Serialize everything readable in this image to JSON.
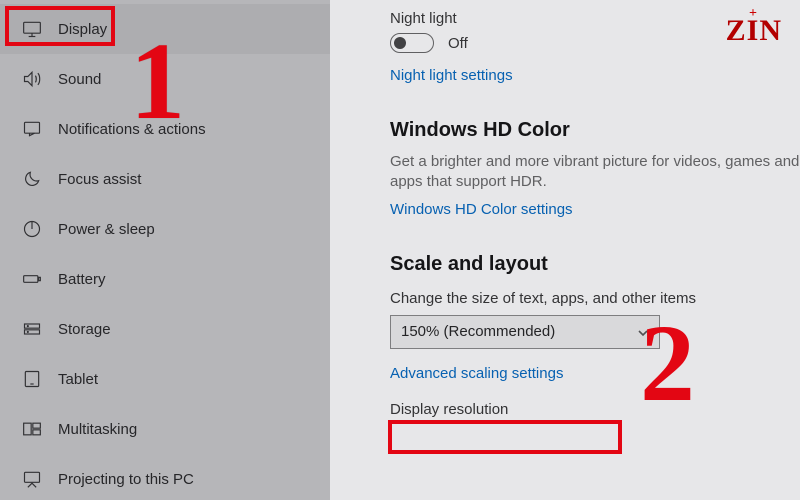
{
  "sidebar": {
    "items": [
      {
        "label": "Display"
      },
      {
        "label": "Sound"
      },
      {
        "label": "Notifications & actions"
      },
      {
        "label": "Focus assist"
      },
      {
        "label": "Power & sleep"
      },
      {
        "label": "Battery"
      },
      {
        "label": "Storage"
      },
      {
        "label": "Tablet"
      },
      {
        "label": "Multitasking"
      },
      {
        "label": "Projecting to this PC"
      }
    ]
  },
  "main": {
    "night_light_label": "Night light",
    "toggle_state": "Off",
    "night_light_link": "Night light settings",
    "hd_color_heading": "Windows HD Color",
    "hd_color_desc": "Get a brighter and more vibrant picture for videos, games and apps that support HDR.",
    "hd_color_link": "Windows HD Color settings",
    "scale_heading": "Scale and layout",
    "scale_field_label": "Change the size of text, apps, and other items",
    "scale_dropdown_value": "150% (Recommended)",
    "advanced_scaling_link": "Advanced scaling settings",
    "resolution_label": "Display resolution"
  },
  "annotations": {
    "num1": "1",
    "num2": "2",
    "logo": "ZIN"
  }
}
